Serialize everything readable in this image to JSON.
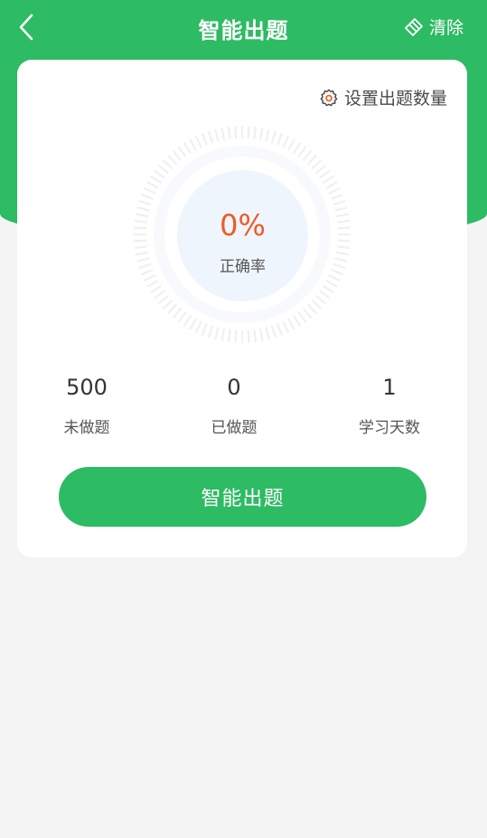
{
  "header": {
    "title": "智能出题",
    "back_icon": "chevron-left-icon",
    "clear_label": "清除",
    "clear_icon": "eraser-icon"
  },
  "card": {
    "settings_label": "设置出题数量",
    "settings_icon": "gear-icon",
    "accuracy_value": "0%",
    "accuracy_label": "正确率",
    "stats": [
      {
        "value": "500",
        "label": "未做题"
      },
      {
        "value": "0",
        "label": "已做题"
      },
      {
        "value": "1",
        "label": "学习天数"
      }
    ],
    "action_label": "智能出题"
  },
  "colors": {
    "brand": "#2dbb64",
    "accent": "#ef5a23",
    "page_bg": "#f4f4f4",
    "dial_inner": "#eff5fd"
  }
}
